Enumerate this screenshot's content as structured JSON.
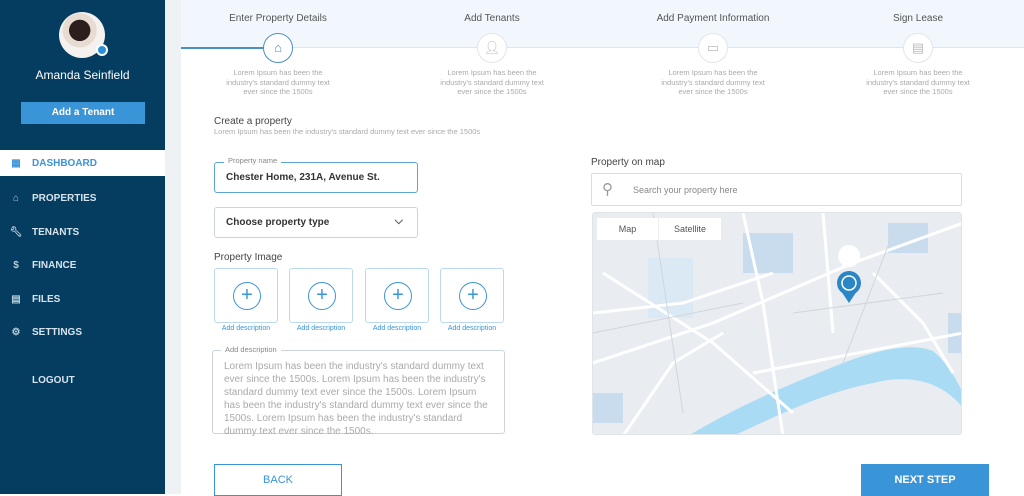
{
  "sidebar": {
    "user_name": "Amanda Seinfield",
    "add_tenant": "Add a Tenant",
    "items": [
      {
        "label": "DASHBOARD",
        "icon": "dashboard-icon",
        "active": true
      },
      {
        "label": "PROPERTIES",
        "icon": "home-icon"
      },
      {
        "label": "TENANTS",
        "icon": "wrench-icon"
      },
      {
        "label": "FINANCE",
        "icon": "dollar-icon"
      },
      {
        "label": "FILES",
        "icon": "file-icon"
      },
      {
        "label": "SETTINGS",
        "icon": "gear-icon"
      }
    ],
    "logout": "LOGOUT"
  },
  "steps": [
    {
      "title": "Enter Property Details",
      "desc": "Lorem Ipsum has been the industry's standard dummy text ever since the 1500s",
      "icon": "house-icon",
      "active": true
    },
    {
      "title": "Add Tenants",
      "desc": "Lorem Ipsum has been the industry's standard dummy text ever since the 1500s",
      "icon": "add-user-icon"
    },
    {
      "title": "Add Payment Information",
      "desc": "Lorem Ipsum has been the industry's standard dummy text ever since the 1500s",
      "icon": "payment-icon"
    },
    {
      "title": "Sign Lease",
      "desc": "Lorem Ipsum has been the industry's standard dummy text ever since the 1500s",
      "icon": "document-icon"
    }
  ],
  "form": {
    "title": "Create a property",
    "subtitle": "Lorem Ipsum has been the industry's standard dummy text ever since the 1500s",
    "property_name_label": "Property name",
    "property_name_value": "Chester Home, 231A, Avenue St.",
    "property_type": "Choose property type",
    "image_label": "Property Image",
    "add_description": "Add description",
    "description_label": "Add description",
    "description_placeholder": "Lorem Ipsum has been the industry's standard dummy text ever since the 1500s. Lorem Ipsum has been the industry's standard dummy text ever since the 1500s. Lorem Ipsum has been the industry's standard dummy text ever since the 1500s. Lorem Ipsum has been the industry's standard dummy text ever since the 1500s."
  },
  "map": {
    "label": "Property on map",
    "search_placeholder": "Search your property here",
    "tab_map": "Map",
    "tab_satellite": "Satellite"
  },
  "buttons": {
    "back": "BACK",
    "next": "NEXT STEP"
  },
  "colors": {
    "sidebar": "#053d60",
    "accent": "#3a95d8"
  }
}
